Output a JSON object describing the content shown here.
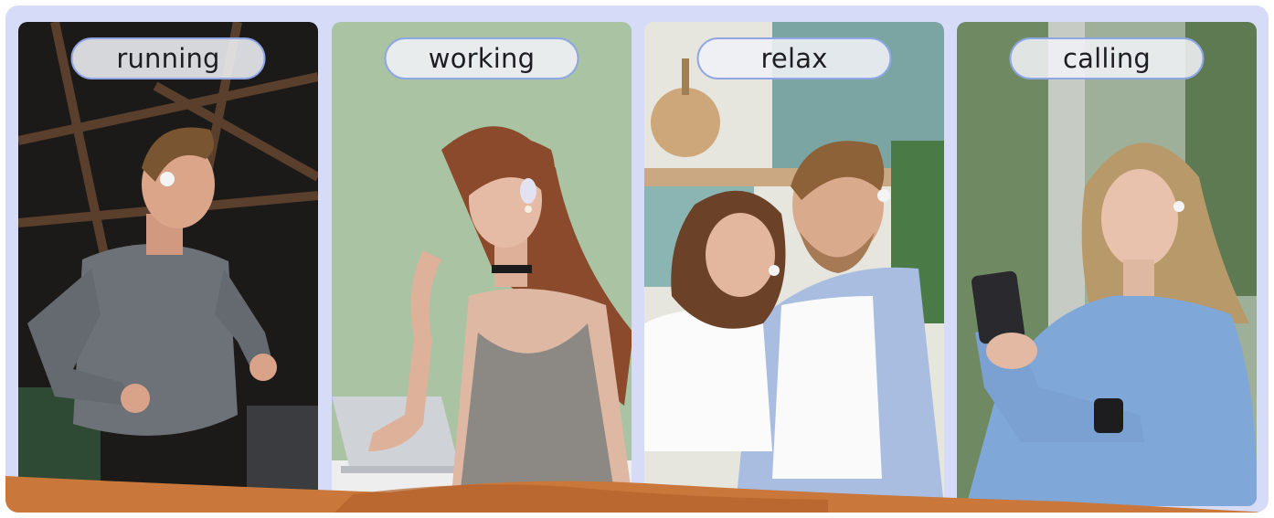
{
  "panels": [
    {
      "label": "running",
      "scene": "man-running-gym-icon"
    },
    {
      "label": "working",
      "scene": "woman-laptop-icon"
    },
    {
      "label": "relax",
      "scene": "couple-relaxing-icon"
    },
    {
      "label": "calling",
      "scene": "woman-phone-icon"
    }
  ],
  "colors": {
    "frame": "#d6dcf8",
    "label_border": "#8fa6e4",
    "blanket": "#c9773a"
  }
}
